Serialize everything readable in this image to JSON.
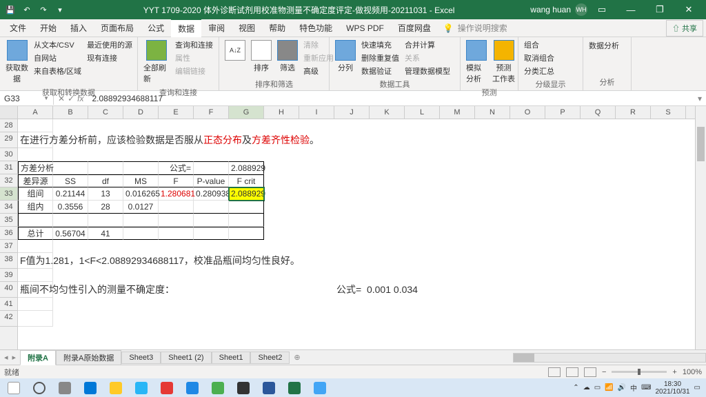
{
  "title": "YYT 1709-2020 体外诊断试剂用校准物测量不确定度评定-做视频用-20211031  -  Excel",
  "user": {
    "name": "wang huan",
    "initials": "WH"
  },
  "menu": {
    "tabs": [
      "文件",
      "开始",
      "插入",
      "页面布局",
      "公式",
      "数据",
      "审阅",
      "视图",
      "帮助",
      "特色功能",
      "WPS PDF",
      "百度网盘"
    ],
    "active": 5,
    "tell": "操作说明搜索",
    "share": "共享"
  },
  "ribbon": {
    "g1": {
      "label": "获取和转换数据",
      "btn": "获取数\n据",
      "items": [
        "从文本/CSV",
        "自网站",
        "来自表格/区域",
        "最近使用的源",
        "现有连接"
      ]
    },
    "g2": {
      "label": "查询和连接",
      "btn": "全部刷新",
      "items": [
        "查询和连接",
        "属性",
        "编辑链接"
      ]
    },
    "g3": {
      "label": "排序和筛选",
      "sort": "排序",
      "filter": "筛选",
      "items": [
        "清除",
        "重新应用",
        "高级"
      ]
    },
    "g4": {
      "label": "数据工具",
      "btn": "分列",
      "items": [
        "快速填充",
        "删除重复值",
        "数据验证",
        "合并计算",
        "关系",
        "管理数据模型"
      ]
    },
    "g5": {
      "label": "预测",
      "b1": "模拟分析",
      "b2": "预测\n工作表"
    },
    "g6": {
      "label": "分级显示",
      "items": [
        "组合",
        "取消组合",
        "分类汇总"
      ]
    },
    "g7": {
      "label": "分析",
      "btn": "数据分析"
    }
  },
  "formula": {
    "cell": "G33",
    "value": "2.08892934688117",
    "fx": "fx"
  },
  "cols": [
    "A",
    "B",
    "C",
    "D",
    "E",
    "F",
    "G",
    "H",
    "I",
    "J",
    "K",
    "L",
    "M",
    "N",
    "O",
    "P",
    "Q",
    "R",
    "S"
  ],
  "selCol": 6,
  "rows": [
    "28",
    "29",
    "30",
    "31",
    "32",
    "33",
    "34",
    "35",
    "36",
    "37",
    "38",
    "39",
    "40",
    "41",
    "42"
  ],
  "t29": {
    "p1": "在进行方差分析前，应该检验数据是否服从",
    "r1": "正态分布",
    "p2": "及",
    "r2": "方差齐性检验",
    "p3": "。"
  },
  "r31": {
    "a": "方差分析",
    "e": "公式=",
    "g": "2.088929"
  },
  "r32": {
    "a": "差异源",
    "b": "SS",
    "c": "df",
    "d": "MS",
    "e": "F",
    "f": "P-value",
    "g": "F crit"
  },
  "r33": {
    "a": "组间",
    "b": "0.21144",
    "c": "13",
    "d": "0.016265",
    "e": "1.280681",
    "f": "0.280938",
    "g": "2.088929"
  },
  "r34": {
    "a": "组内",
    "b": "0.3556",
    "c": "28",
    "d": "0.0127"
  },
  "r36": {
    "a": "总计",
    "b": "0.56704",
    "c": "41"
  },
  "t38": "F值为1.281，1<F<2.08892934688117，校准品瓶间均匀性良好。",
  "r40": {
    "a": "瓶间不均匀性引入的测量不确定度：",
    "j": "公式=",
    "k": "0.001",
    "l": "0.034"
  },
  "sheets": {
    "tabs": [
      "附录A",
      "附录A原始数据",
      "Sheet3",
      "Sheet1 (2)",
      "Sheet1",
      "Sheet2"
    ],
    "active": 0
  },
  "status": {
    "ready": "就绪",
    "zoom": "100%"
  },
  "tray": {
    "ime": "中",
    "time": "18:30",
    "date": "2021/10/31"
  }
}
